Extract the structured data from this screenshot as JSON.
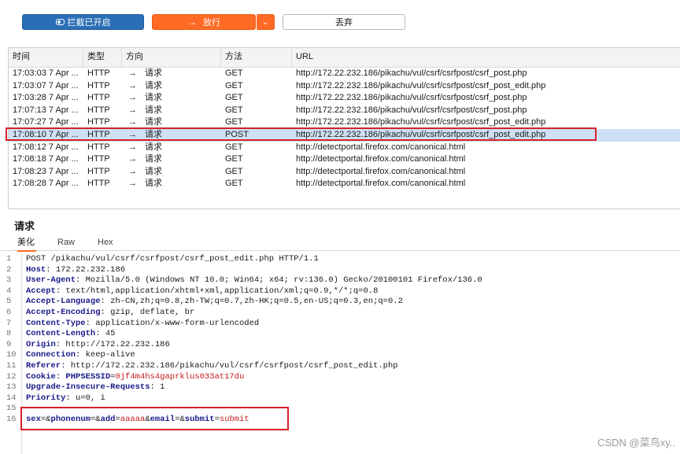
{
  "toolbar": {
    "intercept_label": "拦截已开启",
    "forward_label": "放行",
    "forward_arrow": "→",
    "dropdown_glyph": "⌄",
    "drop_label": "丢弃"
  },
  "history": {
    "columns": {
      "time": "时间",
      "type": "类型",
      "direction": "方向",
      "method": "方法",
      "url": "URL"
    },
    "rows": [
      {
        "time": "17:03:03 7 Apr ...",
        "type": "HTTP",
        "arrow": "→",
        "direction": "请求",
        "method": "GET",
        "url": "http://172.22.232.186/pikachu/vul/csrf/csrfpost/csrf_post.php"
      },
      {
        "time": "17:03:07 7 Apr ...",
        "type": "HTTP",
        "arrow": "→",
        "direction": "请求",
        "method": "GET",
        "url": "http://172.22.232.186/pikachu/vul/csrf/csrfpost/csrf_post_edit.php"
      },
      {
        "time": "17:03:28 7 Apr ...",
        "type": "HTTP",
        "arrow": "→",
        "direction": "请求",
        "method": "GET",
        "url": "http://172.22.232.186/pikachu/vul/csrf/csrfpost/csrf_post.php"
      },
      {
        "time": "17:07:13 7 Apr ...",
        "type": "HTTP",
        "arrow": "→",
        "direction": "请求",
        "method": "GET",
        "url": "http://172.22.232.186/pikachu/vul/csrf/csrfpost/csrf_post.php"
      },
      {
        "time": "17:07:27 7 Apr ...",
        "type": "HTTP",
        "arrow": "→",
        "direction": "请求",
        "method": "GET",
        "url": "http://172.22.232.186/pikachu/vul/csrf/csrfpost/csrf_post_edit.php"
      },
      {
        "time": "17:08:10 7 Apr ...",
        "type": "HTTP",
        "arrow": "→",
        "direction": "请求",
        "method": "POST",
        "url": "http://172.22.232.186/pikachu/vul/csrf/csrfpost/csrf_post_edit.php"
      },
      {
        "time": "17:08:12 7 Apr ...",
        "type": "HTTP",
        "arrow": "→",
        "direction": "请求",
        "method": "GET",
        "url": "http://detectportal.firefox.com/canonical.html"
      },
      {
        "time": "17:08:18 7 Apr ...",
        "type": "HTTP",
        "arrow": "→",
        "direction": "请求",
        "method": "GET",
        "url": "http://detectportal.firefox.com/canonical.html"
      },
      {
        "time": "17:08:23 7 Apr ...",
        "type": "HTTP",
        "arrow": "→",
        "direction": "请求",
        "method": "GET",
        "url": "http://detectportal.firefox.com/canonical.html"
      },
      {
        "time": "17:08:28 7 Apr ...",
        "type": "HTTP",
        "arrow": "→",
        "direction": "请求",
        "method": "GET",
        "url": "http://detectportal.firefox.com/canonical.html"
      }
    ],
    "selected_index": 5
  },
  "request": {
    "title": "请求",
    "tabs": [
      "美化",
      "Raw",
      "Hex"
    ],
    "active_tab": 0,
    "line_numbers": [
      "1",
      "2",
      "3",
      "4",
      "5",
      "6",
      "7",
      "8",
      "9",
      "10",
      "11",
      "12",
      "13",
      "14",
      "15",
      "16"
    ],
    "request_line": "POST /pikachu/vul/csrf/csrfpost/csrf_post_edit.php HTTP/1.1",
    "headers": [
      {
        "name": "Host",
        "value": "172.22.232.186"
      },
      {
        "name": "User-Agent",
        "value": "Mozilla/5.0 (Windows NT 10.0; Win64; x64; rv:136.0) Gecko/20100101 Firefox/136.0"
      },
      {
        "name": "Accept",
        "value": "text/html,application/xhtml+xml,application/xml;q=0.9,*/*;q=0.8"
      },
      {
        "name": "Accept-Language",
        "value": "zh-CN,zh;q=0.8,zh-TW;q=0.7,zh-HK;q=0.5,en-US;q=0.3,en;q=0.2"
      },
      {
        "name": "Accept-Encoding",
        "value": "gzip, deflate, br"
      },
      {
        "name": "Content-Type",
        "value": "application/x-www-form-urlencoded"
      },
      {
        "name": "Content-Length",
        "value": "45"
      },
      {
        "name": "Origin",
        "value": "http://172.22.232.186"
      },
      {
        "name": "Connection",
        "value": "keep-alive"
      },
      {
        "name": "Referer",
        "value": "http://172.22.232.186/pikachu/vul/csrf/csrfpost/csrf_post_edit.php"
      }
    ],
    "cookie": {
      "name": "Cookie",
      "cookie_name": "PHPSESSID",
      "cookie_value": "0jf4m4hs4gaprklus033at17du"
    },
    "headers_after_cookie": [
      {
        "name": "Upgrade-Insecure-Requests",
        "value": "1"
      },
      {
        "name": "Priority",
        "value": "u=0, i"
      }
    ],
    "body_params": [
      {
        "key": "sex",
        "value": ""
      },
      {
        "key": "phonenum",
        "value": ""
      },
      {
        "key": "add",
        "value": "aaaaa"
      },
      {
        "key": "email",
        "value": ""
      },
      {
        "key": "submit",
        "value": "submit"
      }
    ]
  },
  "watermark": "CSDN @菜鸟xy.."
}
